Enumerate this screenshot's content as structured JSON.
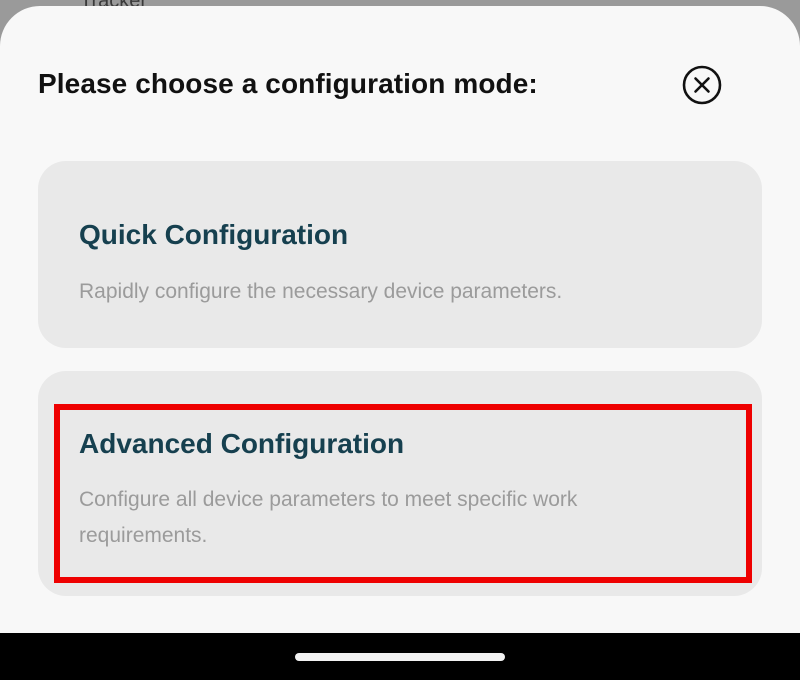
{
  "backdrop": {
    "partial_text": "Tracker"
  },
  "dialog": {
    "title": "Please choose a configuration mode:",
    "close_icon": "close-circle-icon",
    "options": [
      {
        "title": "Quick Configuration",
        "description": "Rapidly configure the necessary device parameters."
      },
      {
        "title": "Advanced Configuration",
        "description": "Configure all device parameters to meet specific work requirements.",
        "highlighted": true
      }
    ]
  },
  "colors": {
    "sheet_background": "#f8f8f8",
    "card_background": "#e9e9e9",
    "option_title": "#16404f",
    "option_description": "#9b9b9b",
    "highlight": "#ee0000",
    "nav_bar": "#000000"
  }
}
